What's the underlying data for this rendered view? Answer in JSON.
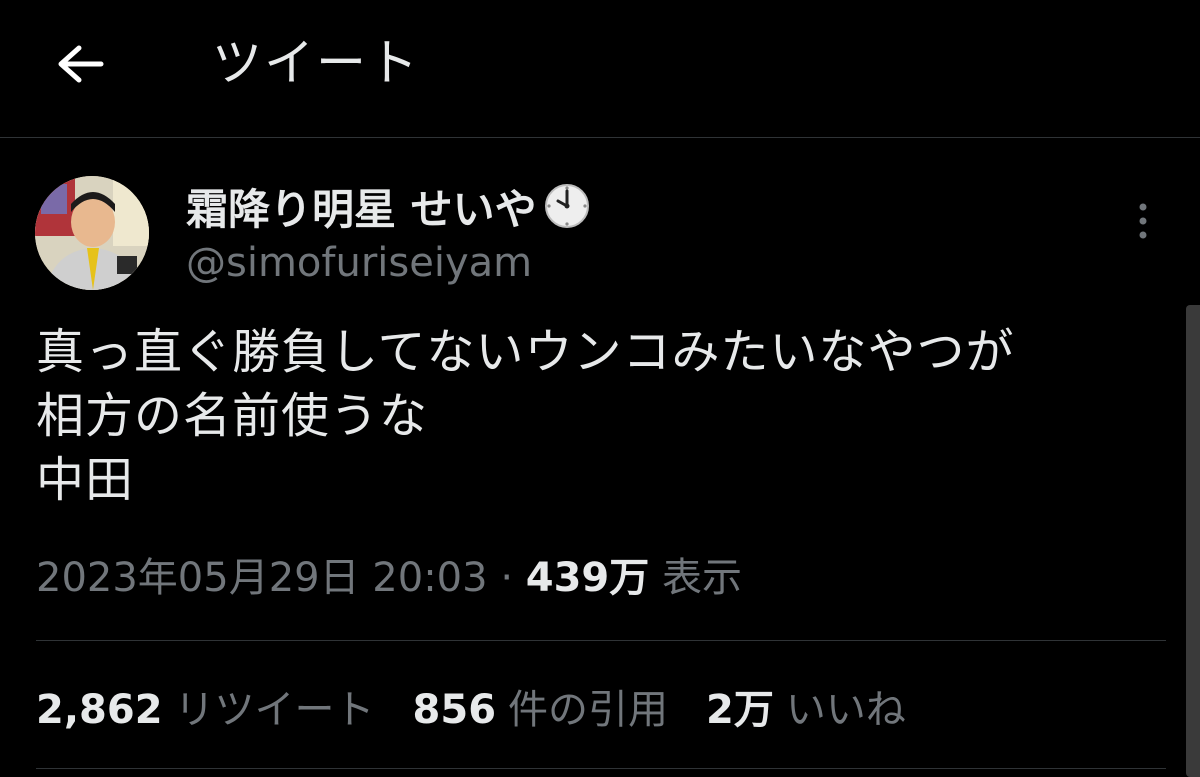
{
  "header": {
    "title": "ツイート",
    "back_icon": "arrow-left-icon"
  },
  "author": {
    "display_name": "霜降り明星 せいや",
    "emoji_icon": "clock-ten-oclock-icon",
    "handle": "@simofuriseiyam"
  },
  "tweet": {
    "lines": [
      "真っ直ぐ勝負してないウンコみたいなやつが",
      "相方の名前使うな",
      "中田"
    ]
  },
  "meta": {
    "timestamp": "2023年05月29日 20:03",
    "separator": "·",
    "views_count": "439万",
    "views_label": "表示"
  },
  "stats": {
    "retweets_count": "2,862",
    "retweets_label": "リツイート",
    "quotes_count": "856",
    "quotes_label": "件の引用",
    "likes_count": "2万",
    "likes_label": "いいね"
  },
  "colors": {
    "background": "#000000",
    "text_primary": "#e7e9ea",
    "text_secondary": "#71767b",
    "divider": "#2f3336"
  }
}
